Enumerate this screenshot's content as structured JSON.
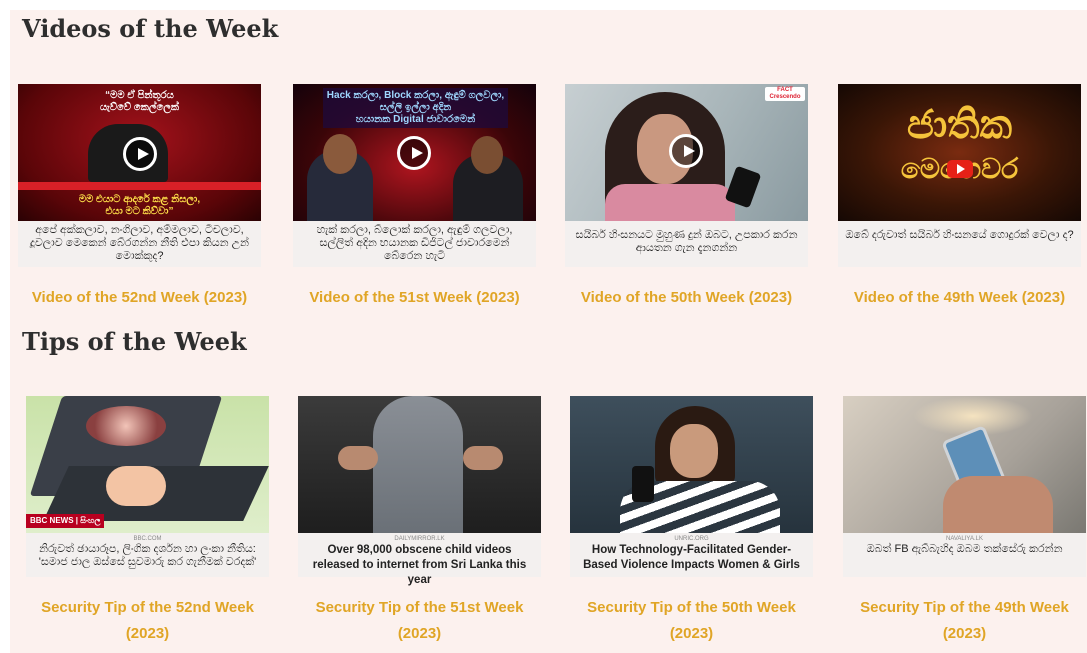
{
  "videos": {
    "title": "Videos of the Week",
    "items": [
      {
        "thumb_quote_1": "“මම ඒ පින්තූරය",
        "thumb_quote_2": "යැව්වේ කෙල්ලෙක්",
        "thumb_quote_3": "මම එයාට ආදරේ කළ නිසලා,",
        "thumb_quote_4": "එයා මට කිව්වා”",
        "caption": "අපේ අක්කලාව, නංගිලාව, අම්මලාව, ටීචලාව, දූවලාව මෙකෙන් බේරගන්න නීති එපා කියන උන් මොක්කුද?",
        "link": "Video of the 52nd Week (2023)"
      },
      {
        "thumb_text": "Hack කරලා, Block කරලා, ඇඳුම් ගලවලා, සල්ලි ඉල්ලා අදින",
        "thumb_text_2": "හයානක Digital ජාවාරමෙන්",
        "caption": "හැක් කරලා, බ්ලොක් කරලා, ඇඳුම් ගලවලා, සල්ලිත් අදින භයානක ඩිජිටල් ජාවාරමෙන් බේරෙන හැටි",
        "link": "Video of the 51st Week (2023)"
      },
      {
        "thumb_logo": "FACT Crescendo",
        "caption": "සයිබර් හිංසනයට මුහුණ දුන් ඔබට, උපකාර කරන ආයතන ගැන දැනගන්න",
        "link": "Video of the 50th Week (2023)"
      },
      {
        "thumb_title_1": "ජාතික",
        "thumb_title_2": "මෙහෙවර",
        "caption": "ඔබේ දරුවාත් සයිබර් හිංසනයේ ගොදුරක් වෙලා ද?",
        "link": "Video of the 49th Week (2023)"
      }
    ]
  },
  "tips": {
    "title": "Tips of the Week",
    "items": [
      {
        "badge": "BBC NEWS | සිංහල",
        "source": "BBC.COM",
        "caption": "නිරුවත් ඡායාරූප, ලිංගික දර්ශන හා ලංකා නීතිය: 'සමාජ ජාල ඔස්සේ සුවමාරු කර ගැනීමක් වරදක්'",
        "link": "Security Tip of the 52nd Week (2023)"
      },
      {
        "source": "DAILYMIRROR.LK",
        "caption": "Over 98,000 obscene child videos released to internet from Sri Lanka this year",
        "link": "Security Tip of the 51st Week (2023)"
      },
      {
        "source": "UNRIC.ORG",
        "caption": "How Technology-Facilitated Gender-Based Violence Impacts Women & Girls",
        "link": "Security Tip of the 50th Week (2023)"
      },
      {
        "source": "NAVALIYA.LK",
        "caption": "ඔබත් FB ඇබ්බැහිද ඔබම තක්සේරු කරන්න",
        "link": "Security Tip of the 49th Week (2023)"
      }
    ]
  },
  "colors": {
    "background": "#fcf1ee",
    "link": "#e0a526",
    "heading": "#2e2e2e"
  }
}
